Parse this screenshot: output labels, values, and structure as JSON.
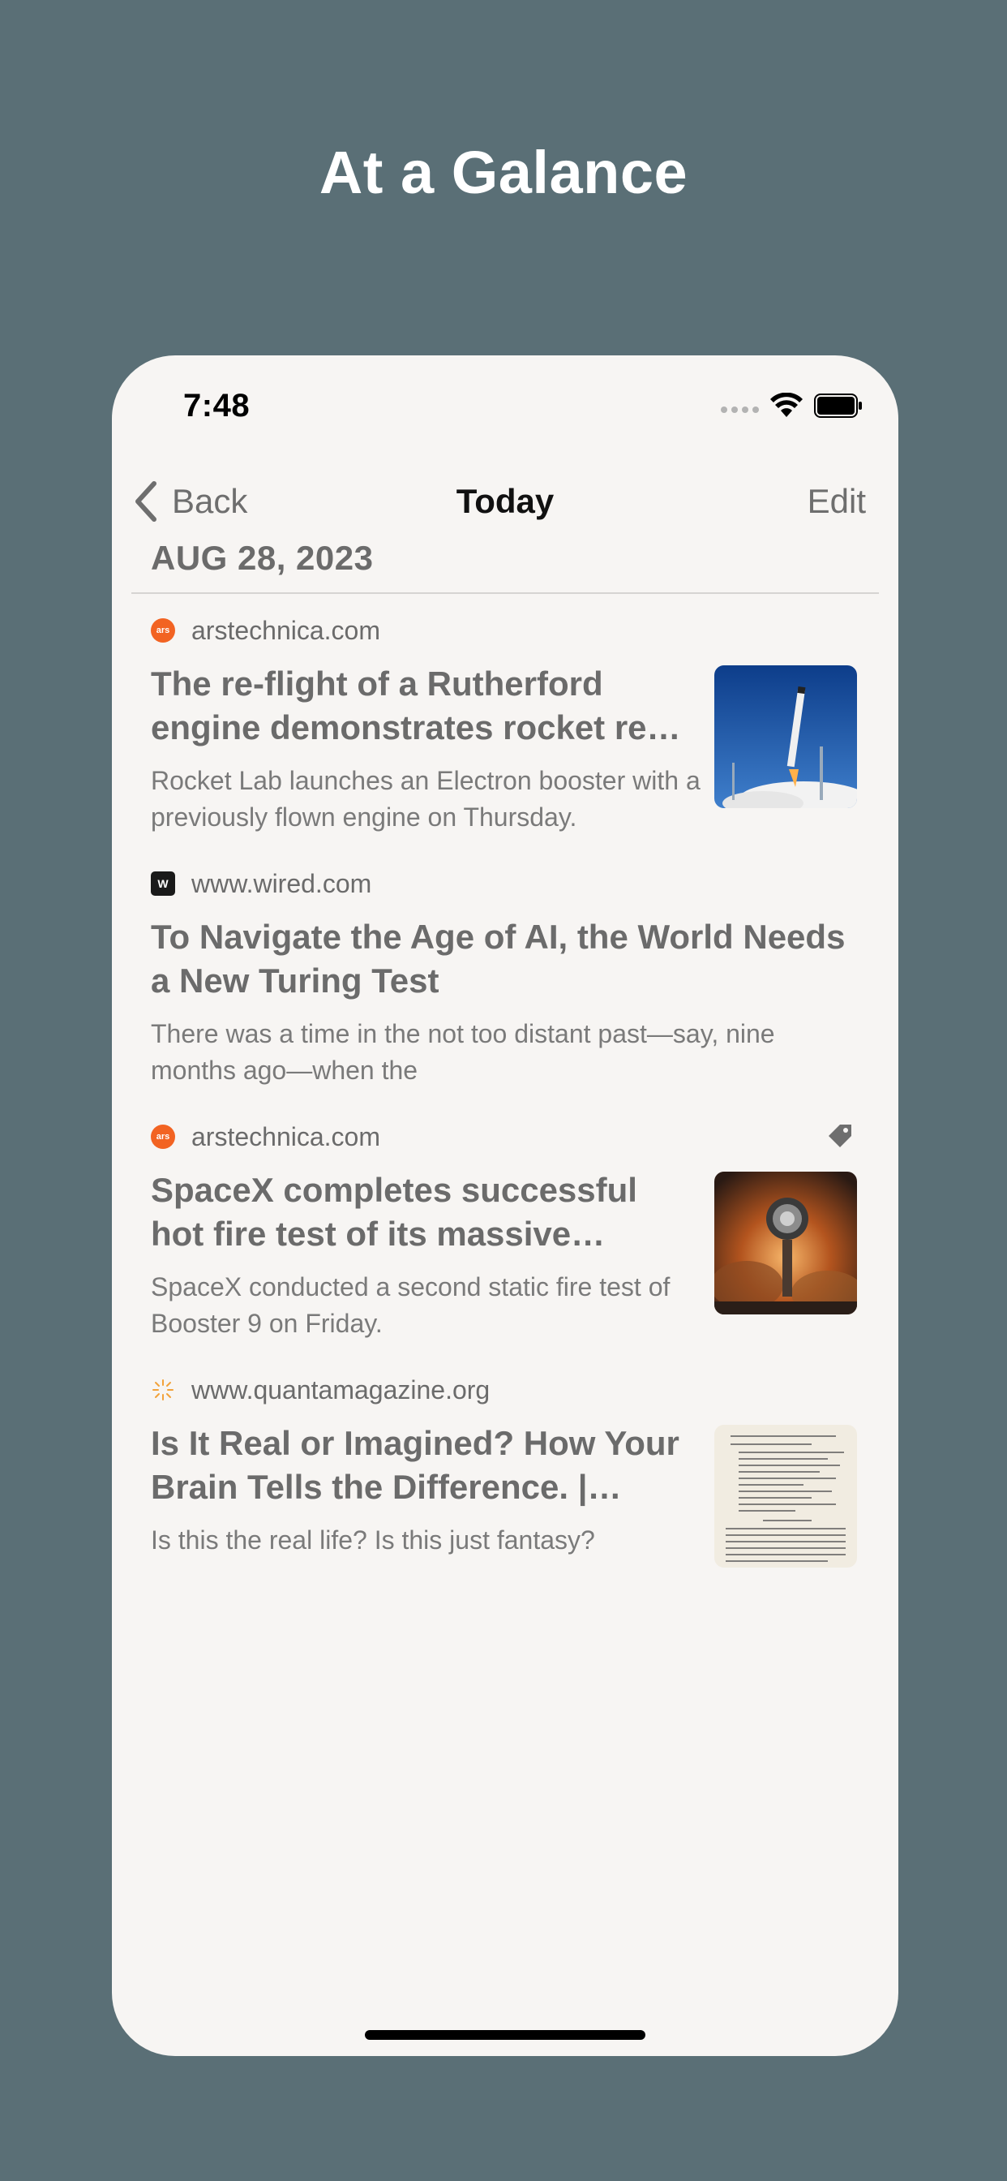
{
  "promo": {
    "headline": "At a Galance"
  },
  "status_bar": {
    "time": "7:48"
  },
  "nav": {
    "back_label": "Back",
    "title": "Today",
    "edit_label": "Edit"
  },
  "section": {
    "date": "AUG 28, 2023"
  },
  "articles": [
    {
      "source": "arstechnica.com",
      "favicon": "ars-favicon-icon",
      "favicon_text": "ars",
      "title": "The re-flight of a Rutherford engine demonstrates rocket re…",
      "summary": "Rocket Lab launches an Electron booster with a previously flown engine on Thursday.",
      "thumbnail": "rocket-launch-thumbnail"
    },
    {
      "source": "www.wired.com",
      "favicon": "wired-favicon-icon",
      "favicon_text": "W",
      "title": "To Navigate the Age of AI, the World Needs a New Turing Test",
      "summary": "There was a time in the not too distant past—say, nine months ago—when the"
    },
    {
      "source": "arstechnica.com",
      "favicon": "ars-favicon-icon",
      "favicon_text": "ars",
      "title": "SpaceX completes successful hot fire test of its massive Stars…",
      "summary": "SpaceX conducted a second static fire test of Booster 9 on Friday.",
      "thumbnail": "booster-fire-thumbnail",
      "tag_icon": "tag-icon"
    },
    {
      "source": "www.quantamagazine.org",
      "favicon": "quanta-favicon-icon",
      "title": "Is It Real or Imagined? How Your Brain Tells the Difference. | Qua…",
      "summary": "Is this the real life? Is this just fantasy?",
      "thumbnail": "document-page-thumbnail"
    }
  ],
  "colors": {
    "background": "#5a6f76",
    "card": "#f7f5f3",
    "text_secondary": "#6b6b6b",
    "ars_orange": "#f26322"
  }
}
